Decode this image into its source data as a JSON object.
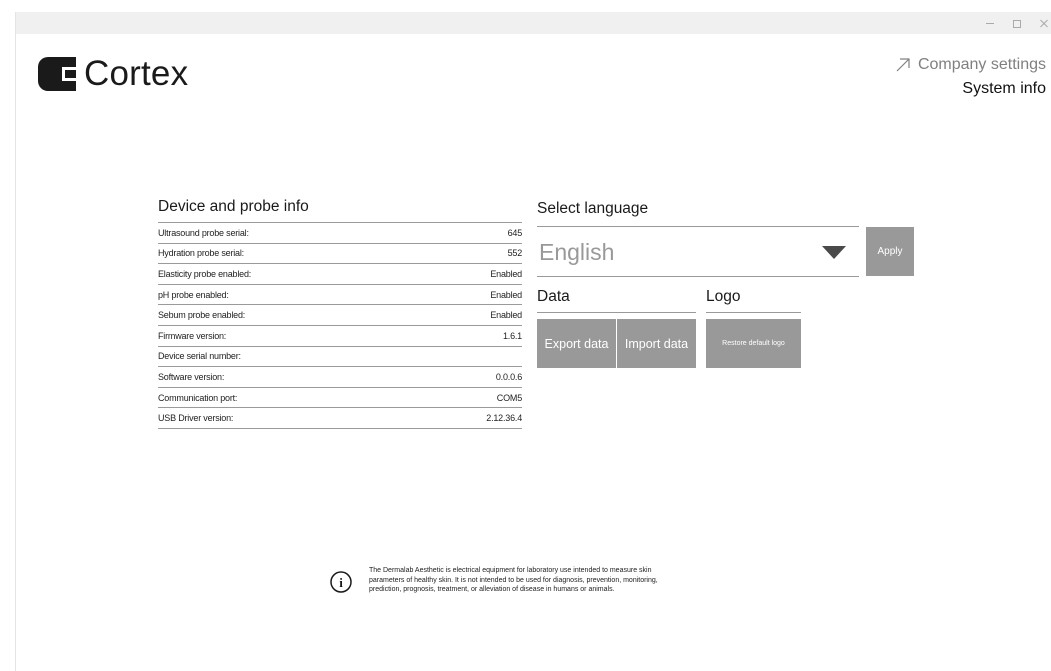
{
  "window": {
    "controls": {
      "minimize_icon": "minimize-icon",
      "maximize_icon": "maximize-icon",
      "close_icon": "close-icon"
    }
  },
  "header": {
    "logo_text": "Cortex",
    "company_settings": "Company settings",
    "system_info": "System info"
  },
  "device": {
    "title": "Device and probe info",
    "rows": [
      {
        "label": "Ultrasound probe serial:",
        "value": "645"
      },
      {
        "label": "Hydration probe serial:",
        "value": "552"
      },
      {
        "label": "Elasticity probe enabled:",
        "value": "Enabled"
      },
      {
        "label": "pH probe enabled:",
        "value": "Enabled"
      },
      {
        "label": "Sebum probe enabled:",
        "value": "Enabled"
      },
      {
        "label": "Firmware version:",
        "value": "1.6.1"
      },
      {
        "label": "Device serial number:",
        "value": ""
      },
      {
        "label": "Software version:",
        "value": "0.0.0.6"
      },
      {
        "label": "Communication port:",
        "value": "COM5"
      },
      {
        "label": "USB Driver version:",
        "value": "2.12.36.4"
      }
    ]
  },
  "language": {
    "title": "Select language",
    "selected": "English",
    "apply_label": "Apply"
  },
  "data_section": {
    "title": "Data",
    "export_label": "Export data",
    "import_label": "Import data"
  },
  "logo_section": {
    "title": "Logo",
    "restore_label": "Restore default logo"
  },
  "disclaimer": {
    "line1": "The Dermalab Aesthetic is electrical equipment for laboratory use intended to measure skin",
    "line2": "parameters of healthy skin. It is not intended to be used for diagnosis, prevention, monitoring,",
    "line3": "prediction, prognosis, treatment, or alleviation of disease in humans or animals."
  },
  "colors": {
    "button_gray": "#999999",
    "divider": "#9a9a9a",
    "muted_text": "#808080"
  }
}
